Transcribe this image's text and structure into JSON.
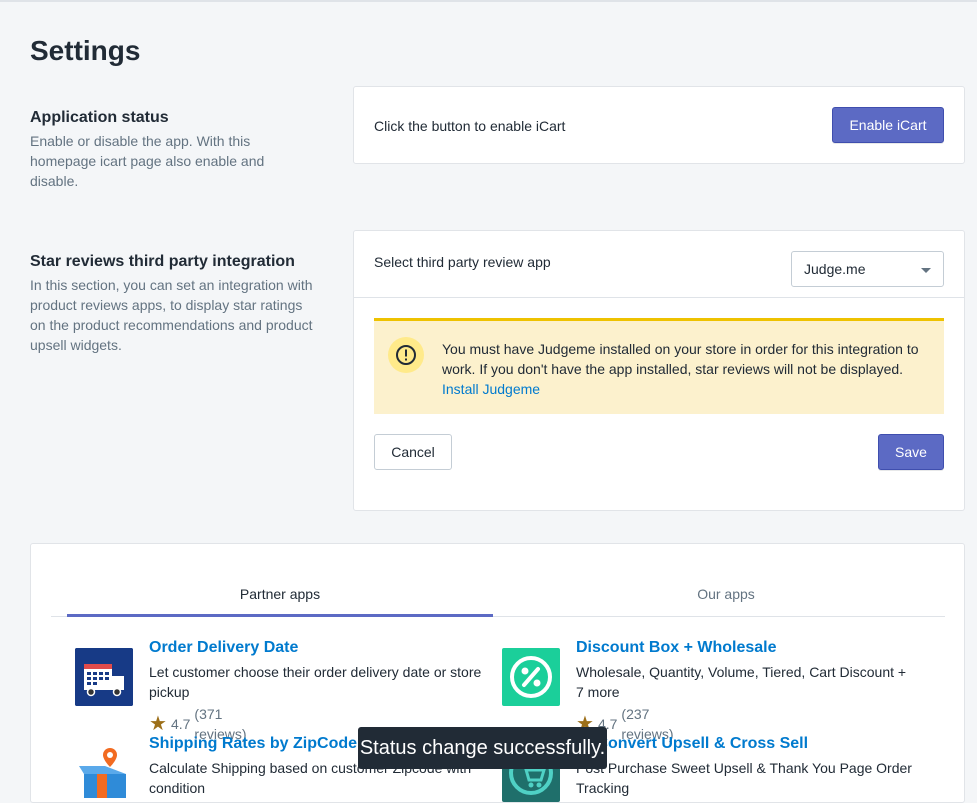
{
  "page": {
    "title": "Settings"
  },
  "app_status": {
    "title": "Application status",
    "description": "Enable or disable the app. With this homepage icart page also enable and disable.",
    "card_text": "Click the button to enable iCart",
    "button_label": "Enable iCart"
  },
  "star_reviews": {
    "title": "Star reviews third party integration",
    "description": "In this section, you can set an integration with product reviews apps, to display star ratings on the product recommendations and product upsell widgets.",
    "select_label": "Select third party review app",
    "select_value": "Judge.me",
    "banner_text": "You must have Judgeme installed on your store in order for this integration to work. If you don't have the app installed, star reviews will not be displayed.",
    "banner_link": "Install Judgeme",
    "cancel_label": "Cancel",
    "save_label": "Save"
  },
  "tabs": [
    {
      "label": "Partner apps",
      "active": true
    },
    {
      "label": "Our apps",
      "active": false
    }
  ],
  "apps": [
    {
      "name": "Order Delivery Date",
      "description": "Let customer choose their order delivery date or store pickup",
      "rating": "4.7",
      "reviews": "(371 reviews)",
      "icon": "delivery-truck-calendar-icon"
    },
    {
      "name": "Discount Box + Wholesale",
      "description": "Wholesale, Quantity, Volume, Tiered, Cart Discount + 7 more",
      "rating": "4.7",
      "reviews": "(237 reviews)",
      "icon": "percent-icon"
    },
    {
      "name": "Shipping Rates by ZipCode",
      "description": "Calculate Shipping based on customer Zipcode with condition",
      "icon": "location-box-icon"
    },
    {
      "name": "ReConvert Upsell & Cross Sell",
      "description": "Post Purchase Sweet Upsell & Thank You Page Order Tracking",
      "icon": "cart-icon"
    }
  ],
  "toast": {
    "message": "Status change successfully."
  },
  "colors": {
    "primary": "#5c6ac4",
    "link": "#007ace",
    "banner_bg": "#fcf1cd",
    "banner_border": "#eec200",
    "toast_bg": "#212b36"
  }
}
